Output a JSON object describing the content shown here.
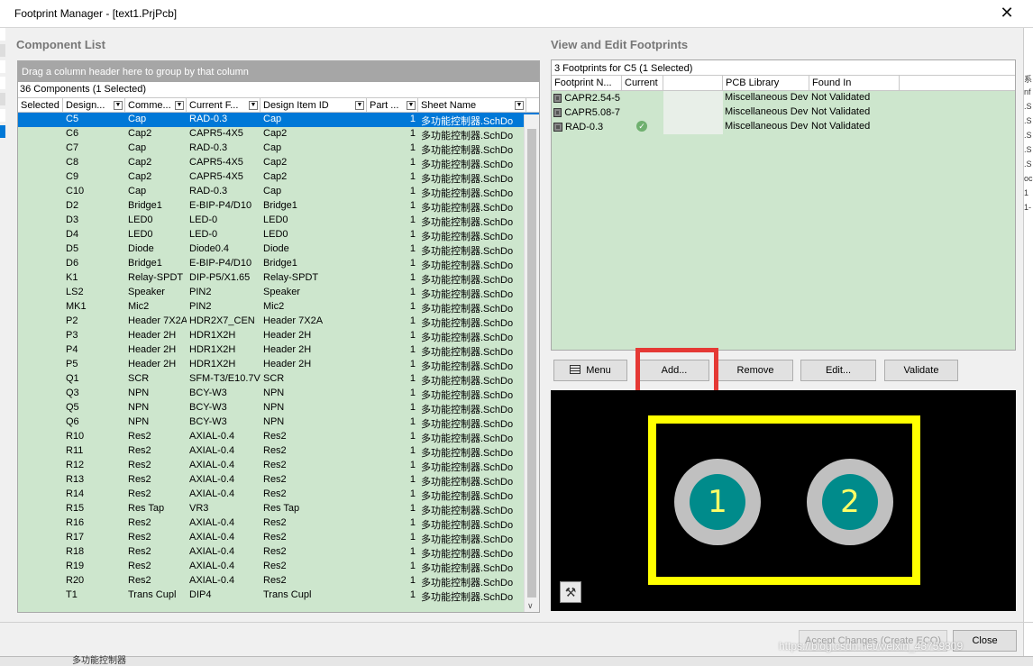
{
  "window": {
    "title": "Footprint Manager - [text1.PrjPcb]",
    "close_glyph": "✕"
  },
  "component_list": {
    "heading": "Component List",
    "group_hint": "Drag a column header here to group by that column",
    "count_label": "36 Components (1 Selected)",
    "columns": [
      "Selected",
      "Design...",
      "Comme...",
      "Current F...",
      "Design Item ID",
      "Part ...",
      "Sheet Name"
    ],
    "rows": [
      {
        "d": "C5",
        "c": "Cap",
        "f": "RAD-0.3",
        "i": "Cap",
        "p": "1",
        "s": "多功能控制器.SchDo",
        "sel": true
      },
      {
        "d": "C6",
        "c": "Cap2",
        "f": "CAPR5-4X5",
        "i": "Cap2",
        "p": "1",
        "s": "多功能控制器.SchDo"
      },
      {
        "d": "C7",
        "c": "Cap",
        "f": "RAD-0.3",
        "i": "Cap",
        "p": "1",
        "s": "多功能控制器.SchDo"
      },
      {
        "d": "C8",
        "c": "Cap2",
        "f": "CAPR5-4X5",
        "i": "Cap2",
        "p": "1",
        "s": "多功能控制器.SchDo"
      },
      {
        "d": "C9",
        "c": "Cap2",
        "f": "CAPR5-4X5",
        "i": "Cap2",
        "p": "1",
        "s": "多功能控制器.SchDo"
      },
      {
        "d": "C10",
        "c": "Cap",
        "f": "RAD-0.3",
        "i": "Cap",
        "p": "1",
        "s": "多功能控制器.SchDo"
      },
      {
        "d": "D2",
        "c": "Bridge1",
        "f": "E-BIP-P4/D10",
        "i": "Bridge1",
        "p": "1",
        "s": "多功能控制器.SchDo"
      },
      {
        "d": "D3",
        "c": "LED0",
        "f": "LED-0",
        "i": "LED0",
        "p": "1",
        "s": "多功能控制器.SchDo"
      },
      {
        "d": "D4",
        "c": "LED0",
        "f": "LED-0",
        "i": "LED0",
        "p": "1",
        "s": "多功能控制器.SchDo"
      },
      {
        "d": "D5",
        "c": "Diode",
        "f": "Diode0.4",
        "i": "Diode",
        "p": "1",
        "s": "多功能控制器.SchDo"
      },
      {
        "d": "D6",
        "c": "Bridge1",
        "f": "E-BIP-P4/D10",
        "i": "Bridge1",
        "p": "1",
        "s": "多功能控制器.SchDo"
      },
      {
        "d": "K1",
        "c": "Relay-SPDT",
        "f": "DIP-P5/X1.65",
        "i": "Relay-SPDT",
        "p": "1",
        "s": "多功能控制器.SchDo"
      },
      {
        "d": "LS2",
        "c": "Speaker",
        "f": "PIN2",
        "i": "Speaker",
        "p": "1",
        "s": "多功能控制器.SchDo"
      },
      {
        "d": "MK1",
        "c": "Mic2",
        "f": "PIN2",
        "i": "Mic2",
        "p": "1",
        "s": "多功能控制器.SchDo"
      },
      {
        "d": "P2",
        "c": "Header 7X2A",
        "f": "HDR2X7_CEN",
        "i": "Header 7X2A",
        "p": "1",
        "s": "多功能控制器.SchDo"
      },
      {
        "d": "P3",
        "c": "Header 2H",
        "f": "HDR1X2H",
        "i": "Header 2H",
        "p": "1",
        "s": "多功能控制器.SchDo"
      },
      {
        "d": "P4",
        "c": "Header 2H",
        "f": "HDR1X2H",
        "i": "Header 2H",
        "p": "1",
        "s": "多功能控制器.SchDo"
      },
      {
        "d": "P5",
        "c": "Header 2H",
        "f": "HDR1X2H",
        "i": "Header 2H",
        "p": "1",
        "s": "多功能控制器.SchDo"
      },
      {
        "d": "Q1",
        "c": "SCR",
        "f": "SFM-T3/E10.7V",
        "i": "SCR",
        "p": "1",
        "s": "多功能控制器.SchDo"
      },
      {
        "d": "Q3",
        "c": "NPN",
        "f": "BCY-W3",
        "i": "NPN",
        "p": "1",
        "s": "多功能控制器.SchDo"
      },
      {
        "d": "Q5",
        "c": "NPN",
        "f": "BCY-W3",
        "i": "NPN",
        "p": "1",
        "s": "多功能控制器.SchDo"
      },
      {
        "d": "Q6",
        "c": "NPN",
        "f": "BCY-W3",
        "i": "NPN",
        "p": "1",
        "s": "多功能控制器.SchDo"
      },
      {
        "d": "R10",
        "c": "Res2",
        "f": "AXIAL-0.4",
        "i": "Res2",
        "p": "1",
        "s": "多功能控制器.SchDo"
      },
      {
        "d": "R11",
        "c": "Res2",
        "f": "AXIAL-0.4",
        "i": "Res2",
        "p": "1",
        "s": "多功能控制器.SchDo"
      },
      {
        "d": "R12",
        "c": "Res2",
        "f": "AXIAL-0.4",
        "i": "Res2",
        "p": "1",
        "s": "多功能控制器.SchDo"
      },
      {
        "d": "R13",
        "c": "Res2",
        "f": "AXIAL-0.4",
        "i": "Res2",
        "p": "1",
        "s": "多功能控制器.SchDo"
      },
      {
        "d": "R14",
        "c": "Res2",
        "f": "AXIAL-0.4",
        "i": "Res2",
        "p": "1",
        "s": "多功能控制器.SchDo"
      },
      {
        "d": "R15",
        "c": "Res Tap",
        "f": "VR3",
        "i": "Res Tap",
        "p": "1",
        "s": "多功能控制器.SchDo"
      },
      {
        "d": "R16",
        "c": "Res2",
        "f": "AXIAL-0.4",
        "i": "Res2",
        "p": "1",
        "s": "多功能控制器.SchDo"
      },
      {
        "d": "R17",
        "c": "Res2",
        "f": "AXIAL-0.4",
        "i": "Res2",
        "p": "1",
        "s": "多功能控制器.SchDo"
      },
      {
        "d": "R18",
        "c": "Res2",
        "f": "AXIAL-0.4",
        "i": "Res2",
        "p": "1",
        "s": "多功能控制器.SchDo"
      },
      {
        "d": "R19",
        "c": "Res2",
        "f": "AXIAL-0.4",
        "i": "Res2",
        "p": "1",
        "s": "多功能控制器.SchDo"
      },
      {
        "d": "R20",
        "c": "Res2",
        "f": "AXIAL-0.4",
        "i": "Res2",
        "p": "1",
        "s": "多功能控制器.SchDo"
      },
      {
        "d": "T1",
        "c": "Trans Cupl",
        "f": "DIP4",
        "i": "Trans Cupl",
        "p": "1",
        "s": "多功能控制器.SchDo"
      }
    ]
  },
  "footprints": {
    "heading": "View and Edit Footprints",
    "count_label": "3 Footprints for C5 (1 Selected)",
    "columns": [
      "Footprint N...",
      "Current",
      "",
      "PCB Library",
      "Found In"
    ],
    "rows": [
      {
        "name": "CAPR2.54-5",
        "current": "",
        "lib": "Miscellaneous Dev",
        "found": "Not Validated"
      },
      {
        "name": "CAPR5.08-7",
        "current": "",
        "lib": "Miscellaneous Dev",
        "found": "Not Validated"
      },
      {
        "name": "RAD-0.3",
        "current": "check",
        "lib": "Miscellaneous Dev",
        "found": "Not Validated"
      }
    ],
    "buttons": {
      "menu": "Menu",
      "add": "Add...",
      "remove": "Remove",
      "edit": "Edit...",
      "validate": "Validate"
    }
  },
  "preview": {
    "pad1": "1",
    "pad2": "2",
    "colors": {
      "outline": "#ffff00",
      "pad_ring": "#c0c0c0",
      "pad_center": "#008b8b",
      "background": "#000000"
    }
  },
  "footer": {
    "accept_label": "Accept Changes (Create ECO)",
    "close_label": "Close",
    "watermark": "https://blog.csdn.net/weixin_43759809"
  },
  "background_window": {
    "right_edge_glyphs": [
      "系",
      "nf",
      ".S",
      ".S",
      ".S",
      ".S",
      ".S",
      "oc",
      "1",
      "1-"
    ],
    "bottom_text": "多功能控制器"
  },
  "icons": {
    "check": "check-icon",
    "menu": "menu-icon",
    "chip": "footprint-chip-icon",
    "tool": "hammer-icon",
    "dropdown": "chevron-down-icon"
  }
}
